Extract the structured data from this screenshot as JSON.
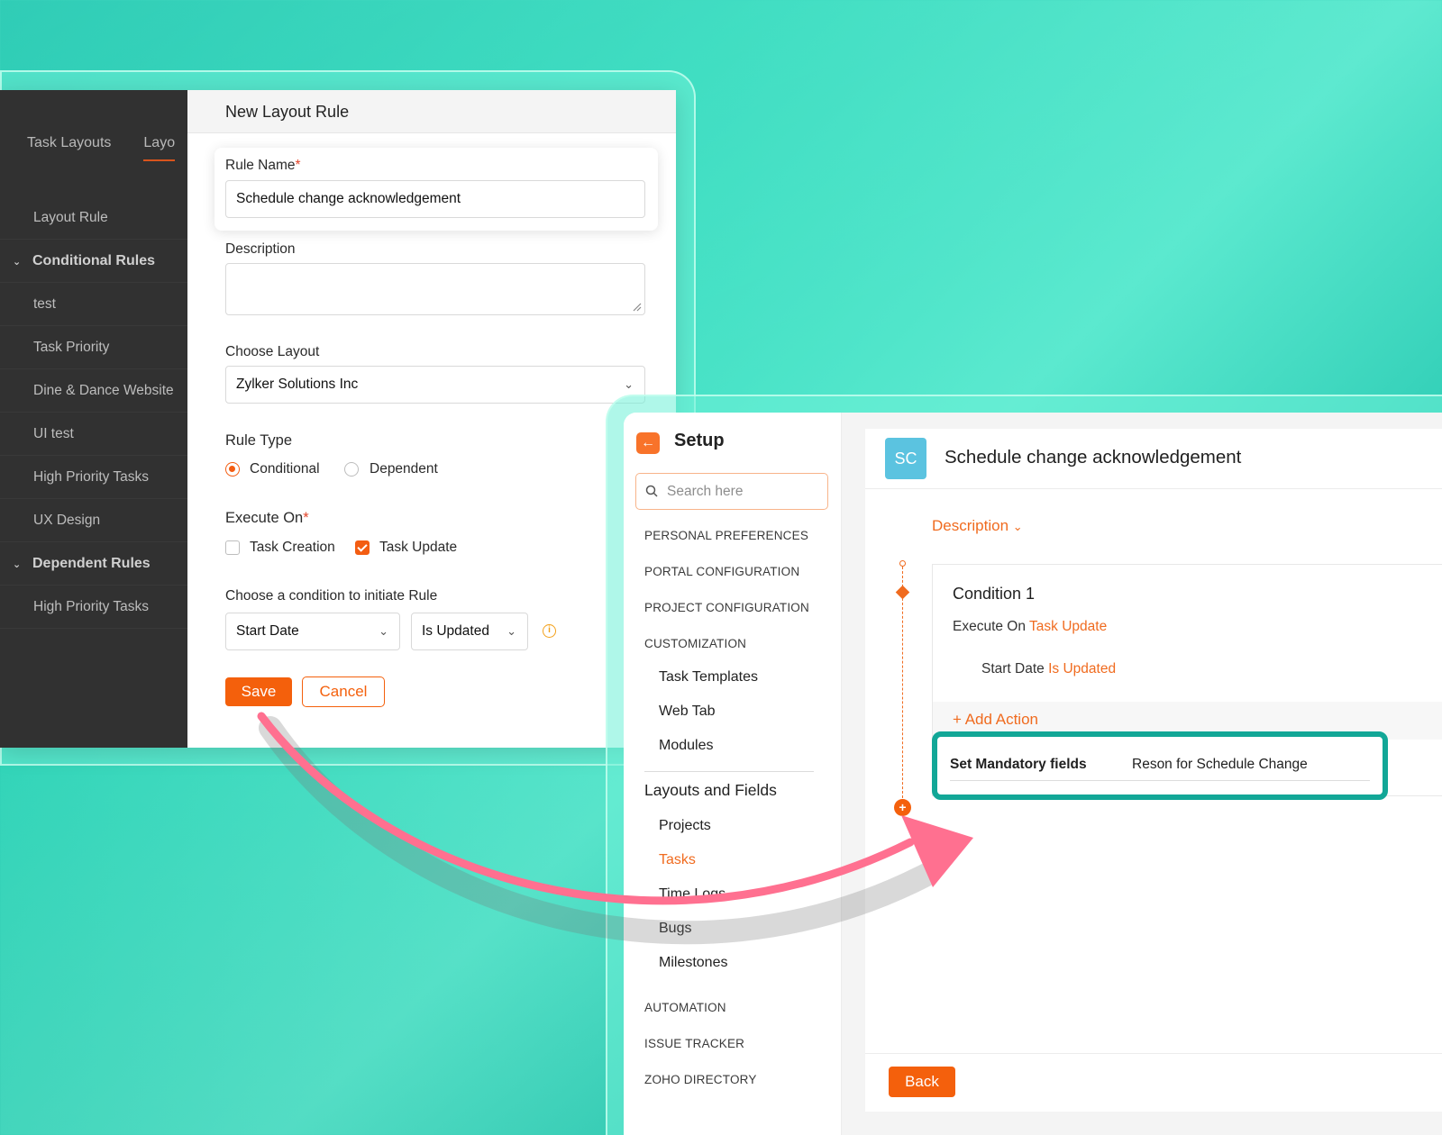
{
  "left_window": {
    "nav": {
      "tabs": [
        "Task Layouts",
        "Layo"
      ],
      "items": [
        {
          "label": "Layout Rule",
          "type": "item"
        },
        {
          "label": "Conditional Rules",
          "type": "group"
        },
        {
          "label": "test",
          "type": "item"
        },
        {
          "label": "Task Priority",
          "type": "item"
        },
        {
          "label": "Dine & Dance Website",
          "type": "item"
        },
        {
          "label": "UI test",
          "type": "item"
        },
        {
          "label": "High Priority Tasks",
          "type": "item"
        },
        {
          "label": "UX Design",
          "type": "item"
        },
        {
          "label": "Dependent Rules",
          "type": "group"
        },
        {
          "label": "High Priority Tasks",
          "type": "item"
        }
      ]
    },
    "dialog": {
      "title": "New Layout Rule",
      "rule_name_label": "Rule Name",
      "rule_name_value": "Schedule change acknowledgement",
      "description_label": "Description",
      "choose_layout_label": "Choose Layout",
      "choose_layout_value": "Zylker Solutions Inc",
      "rule_type_label": "Rule Type",
      "rule_type_options": [
        "Conditional",
        "Dependent"
      ],
      "execute_on_label": "Execute On",
      "execute_on_options": [
        "Task Creation",
        "Task Update"
      ],
      "condition_label": "Choose a condition to initiate Rule",
      "condition_field": "Start Date",
      "condition_operator": "Is Updated",
      "save_label": "Save",
      "cancel_label": "Cancel"
    }
  },
  "right_window": {
    "setup": {
      "title": "Setup",
      "search_placeholder": "Search here",
      "sections": {
        "personal": "PERSONAL PREFERENCES",
        "portal": "PORTAL CONFIGURATION",
        "project": "PROJECT CONFIGURATION",
        "customization": "CUSTOMIZATION",
        "automation": "AUTOMATION",
        "issue": "ISSUE TRACKER",
        "directory": "ZOHO DIRECTORY"
      },
      "customization_items": [
        "Task Templates",
        "Web Tab",
        "Modules"
      ],
      "layouts_title": "Layouts and Fields",
      "layouts_items": [
        "Projects",
        "Tasks",
        "Time Logs",
        "Bugs",
        "Milestones"
      ]
    },
    "rule": {
      "avatar": "SC",
      "title": "Schedule change acknowledgement",
      "description_toggle": "Description",
      "condition_title": "Condition 1",
      "execute_on_prefix": "Execute On",
      "execute_on_value": "Task Update",
      "criteria_field": "Start Date",
      "criteria_operator": "Is Updated",
      "add_action": "+ Add Action",
      "action_label": "Set Mandatory fields",
      "action_value": "Reson for Schedule Change",
      "back_label": "Back"
    }
  },
  "colors": {
    "accent": "#f4600c",
    "highlight_border": "#12a797",
    "arrow": "#ff6b8a"
  }
}
